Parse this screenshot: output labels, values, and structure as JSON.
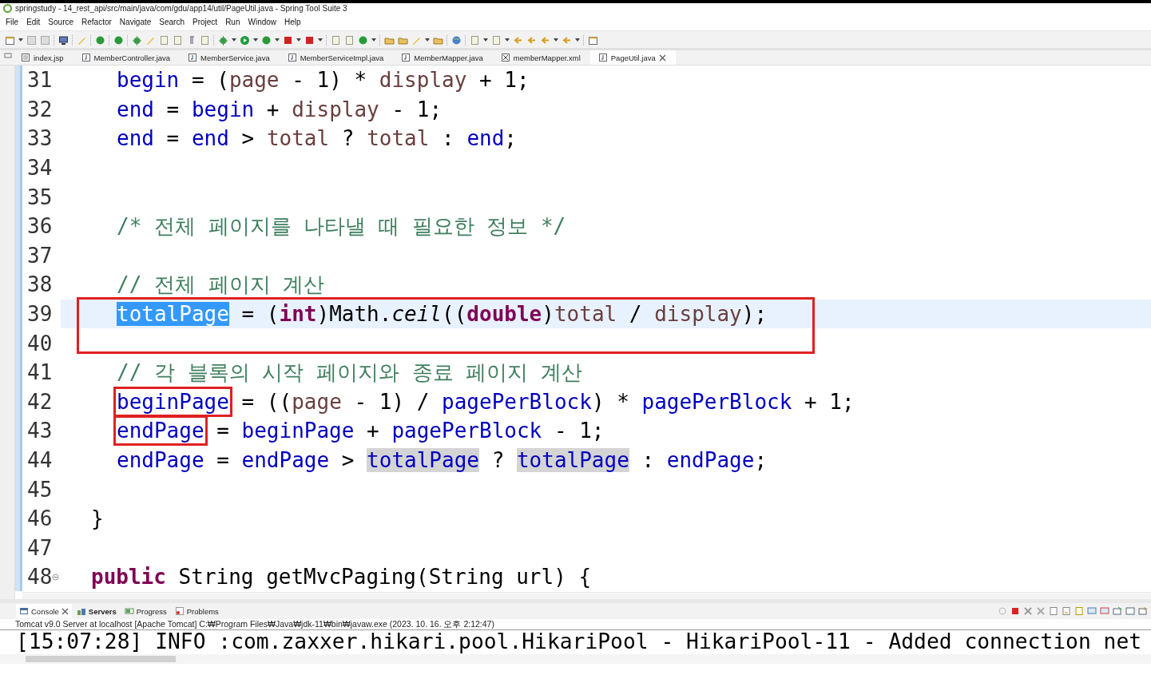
{
  "window": {
    "title": "springstudy - 14_rest_api/src/main/java/com/gdu/app14/util/PageUtil.java - Spring Tool Suite 3"
  },
  "menu": [
    "File",
    "Edit",
    "Source",
    "Refactor",
    "Navigate",
    "Search",
    "Project",
    "Run",
    "Window",
    "Help"
  ],
  "editor_tabs": [
    {
      "label": "index.jsp",
      "kind": "jsp",
      "selected": false
    },
    {
      "label": "MemberController.java",
      "kind": "java",
      "selected": false
    },
    {
      "label": "MemberService.java",
      "kind": "java",
      "selected": false
    },
    {
      "label": "MemberServiceImpl.java",
      "kind": "java",
      "selected": false
    },
    {
      "label": "MemberMapper.java",
      "kind": "java",
      "selected": false
    },
    {
      "label": "memberMapper.xml",
      "kind": "xml",
      "selected": false
    },
    {
      "label": "PageUtil.java",
      "kind": "java",
      "selected": true
    }
  ],
  "code_lines": [
    {
      "number": "31",
      "kind": "statement",
      "tokens": [
        {
          "text": "begin",
          "kind": "field"
        },
        {
          "text": " = (",
          "kind": "plain"
        },
        {
          "text": "page",
          "kind": "local"
        },
        {
          "text": " - 1) * ",
          "kind": "plain"
        },
        {
          "text": "display",
          "kind": "local"
        },
        {
          "text": " + 1;",
          "kind": "plain"
        }
      ]
    },
    {
      "number": "32",
      "kind": "statement",
      "tokens": [
        {
          "text": "end",
          "kind": "field"
        },
        {
          "text": " = ",
          "kind": "plain"
        },
        {
          "text": "begin",
          "kind": "field"
        },
        {
          "text": " + ",
          "kind": "plain"
        },
        {
          "text": "display",
          "kind": "local"
        },
        {
          "text": " - 1;",
          "kind": "plain"
        }
      ]
    },
    {
      "number": "33",
      "kind": "statement",
      "tokens": [
        {
          "text": "end",
          "kind": "field"
        },
        {
          "text": " = ",
          "kind": "plain"
        },
        {
          "text": "end",
          "kind": "field"
        },
        {
          "text": " > ",
          "kind": "plain"
        },
        {
          "text": "total",
          "kind": "local"
        },
        {
          "text": " ? ",
          "kind": "plain"
        },
        {
          "text": "total",
          "kind": "local"
        },
        {
          "text": " : ",
          "kind": "plain"
        },
        {
          "text": "end",
          "kind": "field"
        },
        {
          "text": ";",
          "kind": "plain"
        }
      ]
    },
    {
      "number": "34"
    },
    {
      "number": "35"
    },
    {
      "number": "36",
      "kind": "statement",
      "tokens": [
        {
          "text": "/* 전체 페이지를 나타낼 때 필요한 정보 */",
          "kind": "comment"
        }
      ]
    },
    {
      "number": "37"
    },
    {
      "number": "38",
      "kind": "statement",
      "tokens": [
        {
          "text": "// 전체 페이지 계산",
          "kind": "comment"
        }
      ]
    },
    {
      "number": "39",
      "kind": "statement",
      "current": true,
      "boxed": true,
      "tokens": [
        {
          "text": "totalPage",
          "kind": "field",
          "selected": true
        },
        {
          "text": " = (",
          "kind": "plain"
        },
        {
          "text": "int",
          "kind": "keyword"
        },
        {
          "text": ")Math.",
          "kind": "plain"
        },
        {
          "text": "ceil",
          "kind": "static"
        },
        {
          "text": "((",
          "kind": "plain"
        },
        {
          "text": "double",
          "kind": "keyword"
        },
        {
          "text": ")",
          "kind": "plain"
        },
        {
          "text": "total",
          "kind": "local"
        },
        {
          "text": " / ",
          "kind": "plain"
        },
        {
          "text": "display",
          "kind": "local"
        },
        {
          "text": ");",
          "kind": "plain"
        }
      ]
    },
    {
      "number": "40"
    },
    {
      "number": "41",
      "kind": "statement",
      "tokens": [
        {
          "text": "// 각 블록의 시작 페이지와 종료 페이지 계산",
          "kind": "comment"
        }
      ]
    },
    {
      "number": "42",
      "kind": "statement",
      "tokens": [
        {
          "text": "beginPage",
          "kind": "field",
          "boxed": true
        },
        {
          "text": " = ((",
          "kind": "plain"
        },
        {
          "text": "page",
          "kind": "local"
        },
        {
          "text": " - 1) / ",
          "kind": "plain"
        },
        {
          "text": "pagePerBlock",
          "kind": "field"
        },
        {
          "text": ") * ",
          "kind": "plain"
        },
        {
          "text": "pagePerBlock",
          "kind": "field"
        },
        {
          "text": " + 1;",
          "kind": "plain"
        }
      ]
    },
    {
      "number": "43",
      "kind": "statement",
      "tokens": [
        {
          "text": "endPage",
          "kind": "field",
          "boxed": true
        },
        {
          "text": " = ",
          "kind": "plain"
        },
        {
          "text": "beginPage",
          "kind": "field"
        },
        {
          "text": " + ",
          "kind": "plain"
        },
        {
          "text": "pagePerBlock",
          "kind": "field"
        },
        {
          "text": " - 1;",
          "kind": "plain"
        }
      ]
    },
    {
      "number": "44",
      "kind": "statement",
      "tokens": [
        {
          "text": "endPage",
          "kind": "field"
        },
        {
          "text": " = ",
          "kind": "plain"
        },
        {
          "text": "endPage",
          "kind": "field"
        },
        {
          "text": " > ",
          "kind": "plain"
        },
        {
          "text": "totalPage",
          "kind": "field",
          "highlighted": true
        },
        {
          "text": " ? ",
          "kind": "plain"
        },
        {
          "text": "totalPage",
          "kind": "field",
          "highlighted": true
        },
        {
          "text": " : ",
          "kind": "plain"
        },
        {
          "text": "endPage",
          "kind": "field"
        },
        {
          "text": ";",
          "kind": "plain"
        }
      ]
    },
    {
      "number": "45"
    },
    {
      "number": "46",
      "kind": "member",
      "tokens": [
        {
          "text": "}",
          "kind": "plain"
        }
      ]
    },
    {
      "number": "47"
    },
    {
      "number": "48",
      "kind": "member",
      "foldable": true,
      "tokens": [
        {
          "text": "public",
          "kind": "keyword"
        },
        {
          "text": " String getMvcPaging(String url) {",
          "kind": "plain"
        }
      ]
    }
  ],
  "console": {
    "tabs": [
      {
        "label": "Console",
        "kind": "console",
        "selected": true,
        "emphasized": false
      },
      {
        "label": "Servers",
        "kind": "servers",
        "selected": false,
        "emphasized": true
      },
      {
        "label": "Progress",
        "kind": "progress",
        "selected": false,
        "emphasized": false
      },
      {
        "label": "Problems",
        "kind": "problems",
        "selected": false,
        "emphasized": false
      }
    ],
    "process": "Tomcat v9.0 Server at localhost [Apache Tomcat] C:₩Program Files₩Java₩jdk-11₩bin₩javaw.exe  (2023. 10. 16. 오후 2:12:47)",
    "lines": [
      "[15:07:28] INFO :com.zaxxer.hikari.pool.HikariPool - HikariPool-11 - Added connection net"
    ]
  }
}
